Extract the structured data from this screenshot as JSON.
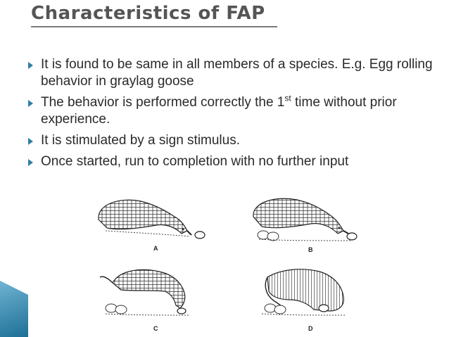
{
  "slide": {
    "title": "Characteristics of FAP",
    "bullets": [
      {
        "text": "It is found to be same in all members of a species. E.g. Egg rolling behavior in graylag goose"
      },
      {
        "pre": "The behavior is performed correctly the 1",
        "sup": "st",
        "post": " time without prior experience."
      },
      {
        "text": "It is stimulated by a sign stimulus."
      },
      {
        "text": "Once started, run to completion with no further input"
      }
    ],
    "figure": {
      "panels": [
        {
          "label": "A"
        },
        {
          "label": "B"
        },
        {
          "label": "C"
        },
        {
          "label": "D"
        }
      ]
    },
    "colors": {
      "title": "#555555",
      "bullet_marker": "#2e7fa6",
      "corner_accent": "#1e6f96"
    }
  }
}
